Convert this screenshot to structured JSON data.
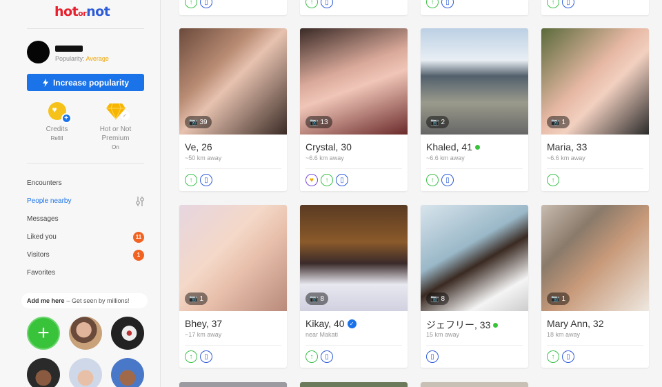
{
  "logo": {
    "hot": "hot",
    "or": "or",
    "not": "not"
  },
  "profile": {
    "popularity_label": "Popularity:",
    "popularity_value": "Average"
  },
  "increase_popularity_label": "Increase popularity",
  "credits": {
    "label": "Credits",
    "sub": "Refill"
  },
  "premium": {
    "label_line1": "Hot or Not",
    "label_line2": "Premium",
    "status": "On"
  },
  "menu": {
    "encounters": "Encounters",
    "people_nearby": "People nearby",
    "messages": "Messages",
    "liked_you": "Liked you",
    "liked_you_count": "11",
    "visitors": "Visitors",
    "visitors_count": "1",
    "favorites": "Favorites"
  },
  "add_me": {
    "bold": "Add me here",
    "rest": "– Get seen by millions!"
  },
  "colors": {
    "accent": "#1a73e8",
    "brand_red": "#e8202e",
    "badge": "#f26322",
    "online": "#39c33a"
  },
  "cards": [
    {
      "name": "Ve, 26",
      "distance": "~50 km away",
      "photos": "39"
    },
    {
      "name": "Crystal, 30",
      "distance": "~6.6 km away",
      "photos": "13"
    },
    {
      "name": "Khaled, 41",
      "distance": "~6.6 km away",
      "photos": "2"
    },
    {
      "name": "Maria, 33",
      "distance": "~6.6 km away",
      "photos": "1"
    },
    {
      "name": "Bhey, 37",
      "distance": "~17 km away",
      "photos": "1"
    },
    {
      "name": "Kikay, 40",
      "distance": "near Makati",
      "photos": "8"
    },
    {
      "name": "ジェフリー, 33",
      "distance": "15 km away",
      "photos": "8"
    },
    {
      "name": "Mary Ann, 32",
      "distance": "18 km away",
      "photos": "1"
    }
  ]
}
